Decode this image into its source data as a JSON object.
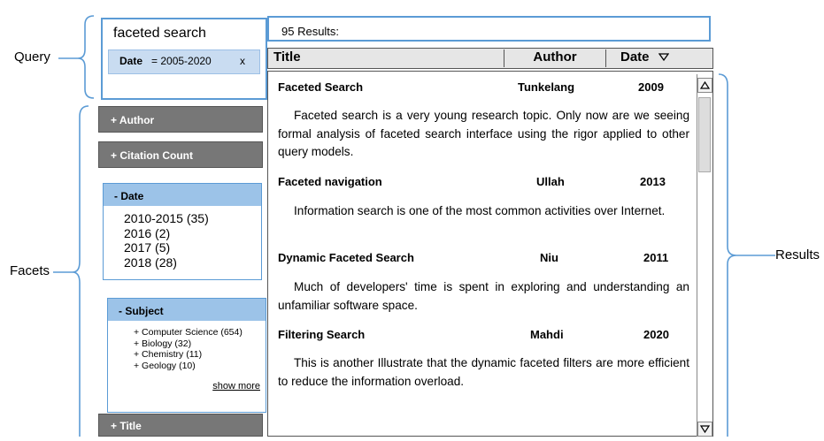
{
  "callouts": {
    "query": "Query",
    "facets": "Facets",
    "results": "Results"
  },
  "query": {
    "text": "faceted search",
    "chip": {
      "key": "Date",
      "value": "= 2005-2020",
      "remove": "x"
    }
  },
  "facets": {
    "author": "+ Author",
    "citation_count": "+ Citation Count",
    "date": {
      "header": "- Date",
      "items": [
        "2010-2015 (35)",
        "2016 (2)",
        "2017 (5)",
        "2018 (28)"
      ]
    },
    "subject": {
      "header": "- Subject",
      "items": [
        "+ Computer Science (654)",
        "+ Biology (32)",
        "+ Chemistry (11)",
        "+ Geology (10)"
      ],
      "show_more": "show more"
    },
    "title": "+ Title"
  },
  "results": {
    "count": "95 Results:",
    "columns": {
      "title": "Title",
      "author": "Author",
      "date": "Date",
      "sort_icon": "triangle-down-icon"
    },
    "items": [
      {
        "title": "Faceted Search",
        "author": "Tunkelang",
        "year": "2009",
        "abstract": "Faceted search is a very young research topic. Only now are we seeing formal analysis of faceted search interface using the rigor applied to other query models."
      },
      {
        "title": "Faceted navigation",
        "author": "Ullah",
        "year": "2013",
        "abstract": "Information search is one of the most common activities over Internet."
      },
      {
        "title": "Dynamic Faceted Search",
        "author": "Niu",
        "year": "2011",
        "abstract": "Much of developers' time is spent in exploring and understanding an unfamiliar software space."
      },
      {
        "title": "Filtering Search",
        "author": "Mahdi",
        "year": "2020",
        "abstract": "This is another Illustrate that the dynamic faceted filters are more efficient to reduce the information overload."
      }
    ]
  },
  "colors": {
    "accent": "#5b9bd5",
    "facet_gray": "#777777",
    "facet_open": "#9cc3e8",
    "chip": "#c9dcf1"
  }
}
